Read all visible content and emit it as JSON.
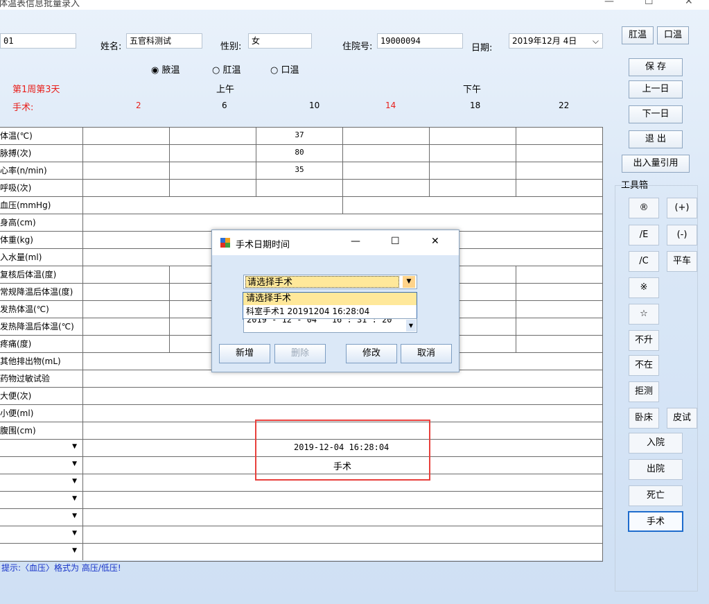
{
  "window": {
    "title": "体温表信息批量录入",
    "min": "—",
    "max": "☐",
    "close": "✕"
  },
  "header": {
    "id_value": "01",
    "name_label": "姓名:",
    "name_value": "五官科测试",
    "gender_label": "性别:",
    "gender_value": "女",
    "admission_label": "住院号:",
    "admission_value": "19000094",
    "date_label": "日期:",
    "date_value": "2019年12月 4日"
  },
  "temp_mode": {
    "options": [
      "腋温",
      "肛温",
      "口温"
    ],
    "selected": 0
  },
  "schedule": {
    "week_day": "第1周第3天",
    "surgery_label": "手术:",
    "am": "上午",
    "pm": "下午",
    "slots": [
      "2",
      "6",
      "10",
      "14",
      "18",
      "22"
    ]
  },
  "colors": {
    "red": "#e8201c",
    "accent": "#1e6ccd"
  },
  "rows": [
    {
      "label": "体温(℃)",
      "cells": [
        "",
        "",
        "37",
        "",
        "",
        ""
      ]
    },
    {
      "label": "脉搏(次)",
      "cells": [
        "",
        "",
        "80",
        "",
        "",
        ""
      ]
    },
    {
      "label": "心率(n/min)",
      "cells": [
        "",
        "",
        "35",
        "",
        "",
        ""
      ]
    },
    {
      "label": "呼吸(次)",
      "cells": [
        "",
        "",
        "",
        "",
        "",
        ""
      ]
    },
    {
      "label": "血压(mmHg)",
      "cells": [
        "",
        ""
      ]
    },
    {
      "label": "身高(cm)",
      "cells": [
        ""
      ]
    },
    {
      "label": "体重(kg)",
      "cells": [
        ""
      ]
    },
    {
      "label": "入水量(ml)",
      "cells": [
        ""
      ]
    },
    {
      "label": "复核后体温(度)",
      "cells": [
        "",
        "",
        "",
        "",
        "",
        ""
      ]
    },
    {
      "label": "常规降温后体温(度)",
      "cells": [
        "",
        "",
        "",
        "",
        "",
        ""
      ]
    },
    {
      "label": "发热体温(℃)",
      "cells": [
        "",
        "",
        "",
        "",
        "",
        ""
      ]
    },
    {
      "label": "发热降温后体温(℃)",
      "cells": [
        "",
        "",
        "",
        "",
        "",
        ""
      ]
    },
    {
      "label": "疼痛(度)",
      "cells": [
        "",
        "",
        "",
        "",
        "",
        ""
      ]
    },
    {
      "label": "其他排出物(mL)",
      "cells": [
        ""
      ]
    },
    {
      "label": "药物过敏试验",
      "cells": [
        ""
      ]
    },
    {
      "label": "大便(次)",
      "cells": [
        ""
      ]
    },
    {
      "label": "小便(ml)",
      "cells": [
        ""
      ]
    },
    {
      "label": "腹围(cm)",
      "cells": [
        ""
      ]
    }
  ],
  "event_box": {
    "timestamp": "2019-12-04 16:28:04",
    "event": "手术"
  },
  "hint": "提示:〈血压〉格式为 高压/低压!",
  "sidebar": {
    "rectal": "肛温",
    "oral": "口温",
    "save": "保 存",
    "prev": "上一日",
    "next": "下一日",
    "exit": "退 出",
    "intake_ref": "出入量引用",
    "toolbox_title": "工具箱"
  },
  "toolbox": {
    "items": [
      "®",
      "(+)",
      "/E",
      "(-)",
      "/C",
      "平车",
      "※",
      "☆",
      "不升",
      "不在",
      "拒测",
      "卧床",
      "皮试",
      "入院",
      "出院",
      "死亡",
      "手术"
    ]
  },
  "dialog": {
    "title": "手术日期时间",
    "min": "—",
    "max": "☐",
    "close": "✕",
    "combo_value": "请选择手术",
    "list": [
      "请选择手术",
      "科室手术1 20191204 16:28:04"
    ],
    "datetime_value": "2019 - 12 - 04   16 : 31 : 20",
    "btn_new": "新增",
    "btn_delete": "删除",
    "btn_edit": "修改",
    "btn_cancel": "取消"
  }
}
